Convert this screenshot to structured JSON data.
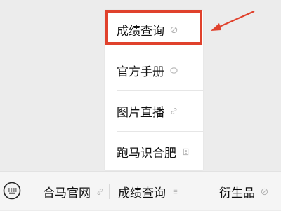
{
  "popup_menu": {
    "items": [
      {
        "label": "成绩查询",
        "icon": "forbidden-icon"
      },
      {
        "label": "官方手册",
        "icon": "circle-icon"
      },
      {
        "label": "图片直播",
        "icon": "link-icon"
      },
      {
        "label": "跑马识合肥",
        "icon": "page-icon"
      }
    ]
  },
  "bottom_bar": {
    "keyboard_icon": "keyboard-icon",
    "tabs": [
      {
        "label": "合马官网",
        "icon": "link-icon"
      },
      {
        "label": "成绩查询",
        "icon": "menu-icon"
      },
      {
        "label": "衍生品",
        "icon": "forbidden-icon"
      }
    ]
  },
  "colors": {
    "highlight": "#e0412c",
    "background": "#ececec",
    "menu_background": "#ffffff",
    "bar_background": "#f5f5f5"
  }
}
